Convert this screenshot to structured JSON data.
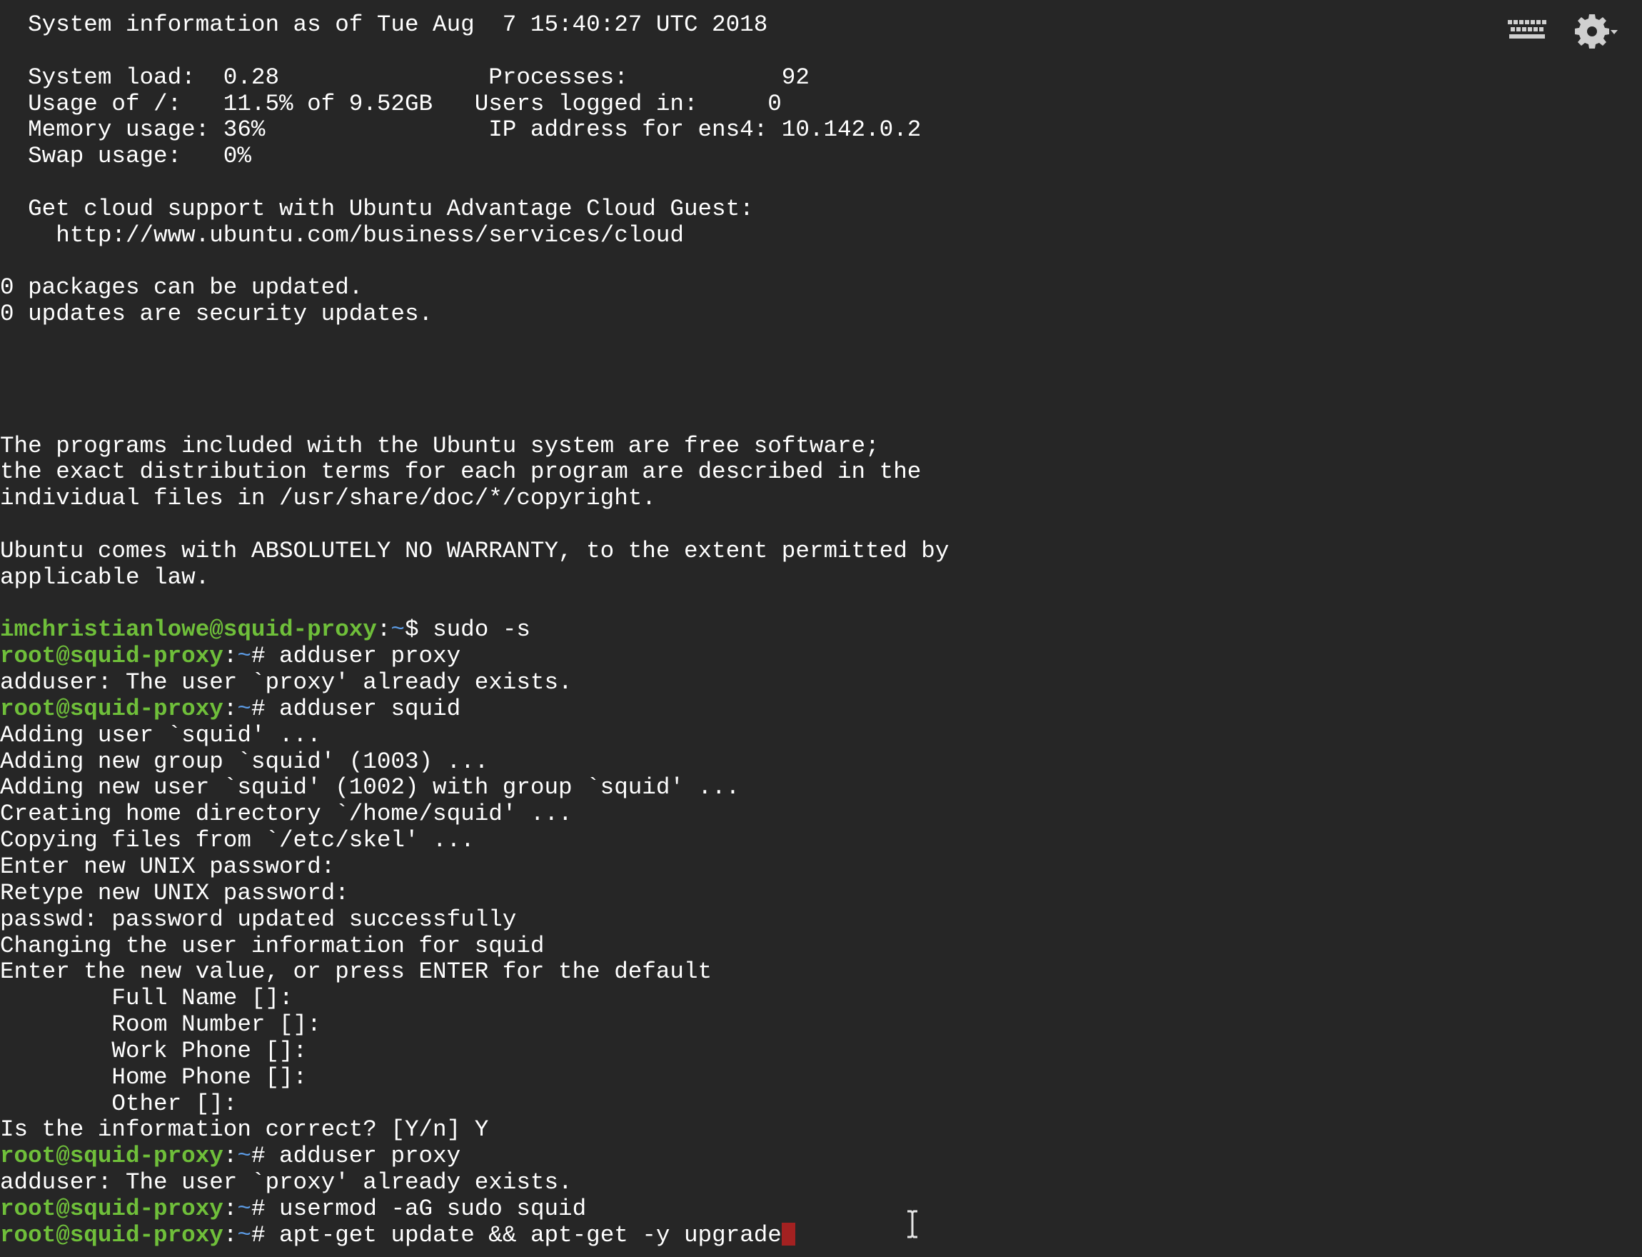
{
  "terminal": {
    "lines": [
      {
        "segments": [
          {
            "t": "  System information as of Tue Aug  7 15:40:27 UTC 2018"
          }
        ]
      },
      {
        "segments": [
          {
            "t": ""
          }
        ]
      },
      {
        "segments": [
          {
            "t": "  System load:  0.28               Processes:           92"
          }
        ]
      },
      {
        "segments": [
          {
            "t": "  Usage of /:   11.5% of 9.52GB   Users logged in:     0"
          }
        ]
      },
      {
        "segments": [
          {
            "t": "  Memory usage: 36%                IP address for ens4: 10.142.0.2"
          }
        ]
      },
      {
        "segments": [
          {
            "t": "  Swap usage:   0%"
          }
        ]
      },
      {
        "segments": [
          {
            "t": ""
          }
        ]
      },
      {
        "segments": [
          {
            "t": "  Get cloud support with Ubuntu Advantage Cloud Guest:"
          }
        ]
      },
      {
        "segments": [
          {
            "t": "    http://www.ubuntu.com/business/services/cloud"
          }
        ]
      },
      {
        "segments": [
          {
            "t": ""
          }
        ]
      },
      {
        "segments": [
          {
            "t": "0 packages can be updated."
          }
        ]
      },
      {
        "segments": [
          {
            "t": "0 updates are security updates."
          }
        ]
      },
      {
        "segments": [
          {
            "t": ""
          }
        ]
      },
      {
        "segments": [
          {
            "t": ""
          }
        ]
      },
      {
        "segments": [
          {
            "t": ""
          }
        ]
      },
      {
        "segments": [
          {
            "t": ""
          }
        ]
      },
      {
        "segments": [
          {
            "t": "The programs included with the Ubuntu system are free software;"
          }
        ]
      },
      {
        "segments": [
          {
            "t": "the exact distribution terms for each program are described in the"
          }
        ]
      },
      {
        "segments": [
          {
            "t": "individual files in /usr/share/doc/*/copyright."
          }
        ]
      },
      {
        "segments": [
          {
            "t": ""
          }
        ]
      },
      {
        "segments": [
          {
            "t": "Ubuntu comes with ABSOLUTELY NO WARRANTY, to the extent permitted by"
          }
        ]
      },
      {
        "segments": [
          {
            "t": "applicable law."
          }
        ]
      },
      {
        "segments": [
          {
            "t": ""
          }
        ]
      },
      {
        "segments": [
          {
            "t": "imchristianlowe@squid-proxy",
            "c": "user"
          },
          {
            "t": ":"
          },
          {
            "t": "~",
            "c": "path"
          },
          {
            "t": "$ sudo -s"
          }
        ]
      },
      {
        "segments": [
          {
            "t": "root@squid-proxy",
            "c": "user"
          },
          {
            "t": ":"
          },
          {
            "t": "~",
            "c": "path"
          },
          {
            "t": "# adduser proxy"
          }
        ]
      },
      {
        "segments": [
          {
            "t": "adduser: The user `proxy' already exists."
          }
        ]
      },
      {
        "segments": [
          {
            "t": "root@squid-proxy",
            "c": "user"
          },
          {
            "t": ":"
          },
          {
            "t": "~",
            "c": "path"
          },
          {
            "t": "# adduser squid"
          }
        ]
      },
      {
        "segments": [
          {
            "t": "Adding user `squid' ..."
          }
        ]
      },
      {
        "segments": [
          {
            "t": "Adding new group `squid' (1003) ..."
          }
        ]
      },
      {
        "segments": [
          {
            "t": "Adding new user `squid' (1002) with group `squid' ..."
          }
        ]
      },
      {
        "segments": [
          {
            "t": "Creating home directory `/home/squid' ..."
          }
        ]
      },
      {
        "segments": [
          {
            "t": "Copying files from `/etc/skel' ..."
          }
        ]
      },
      {
        "segments": [
          {
            "t": "Enter new UNIX password:"
          }
        ]
      },
      {
        "segments": [
          {
            "t": "Retype new UNIX password:"
          }
        ]
      },
      {
        "segments": [
          {
            "t": "passwd: password updated successfully"
          }
        ]
      },
      {
        "segments": [
          {
            "t": "Changing the user information for squid"
          }
        ]
      },
      {
        "segments": [
          {
            "t": "Enter the new value, or press ENTER for the default"
          }
        ]
      },
      {
        "segments": [
          {
            "t": "        Full Name []:"
          }
        ]
      },
      {
        "segments": [
          {
            "t": "        Room Number []:"
          }
        ]
      },
      {
        "segments": [
          {
            "t": "        Work Phone []:"
          }
        ]
      },
      {
        "segments": [
          {
            "t": "        Home Phone []:"
          }
        ]
      },
      {
        "segments": [
          {
            "t": "        Other []:"
          }
        ]
      },
      {
        "segments": [
          {
            "t": "Is the information correct? [Y/n] Y"
          }
        ]
      },
      {
        "segments": [
          {
            "t": "root@squid-proxy",
            "c": "user"
          },
          {
            "t": ":"
          },
          {
            "t": "~",
            "c": "path"
          },
          {
            "t": "# adduser proxy"
          }
        ]
      },
      {
        "segments": [
          {
            "t": "adduser: The user `proxy' already exists."
          }
        ]
      },
      {
        "segments": [
          {
            "t": "root@squid-proxy",
            "c": "user"
          },
          {
            "t": ":"
          },
          {
            "t": "~",
            "c": "path"
          },
          {
            "t": "# usermod -aG sudo squid"
          }
        ]
      },
      {
        "segments": [
          {
            "t": "root@squid-proxy",
            "c": "user"
          },
          {
            "t": ":"
          },
          {
            "t": "~",
            "c": "path"
          },
          {
            "t": "# apt-get update && apt-get -y upgrade"
          },
          {
            "t": "",
            "c": "cursor"
          }
        ]
      }
    ]
  },
  "toolbar": {
    "keyboard_icon": "keyboard-icon",
    "settings_icon": "gear-icon",
    "settings_dropdown_icon": "caret-down-icon"
  },
  "colors": {
    "background": "#262626",
    "text": "#ffffff",
    "prompt_user": "#6fbf3a",
    "prompt_path": "#5c9ce6",
    "cursor": "#a32121",
    "icons": "#cfcfcf"
  }
}
